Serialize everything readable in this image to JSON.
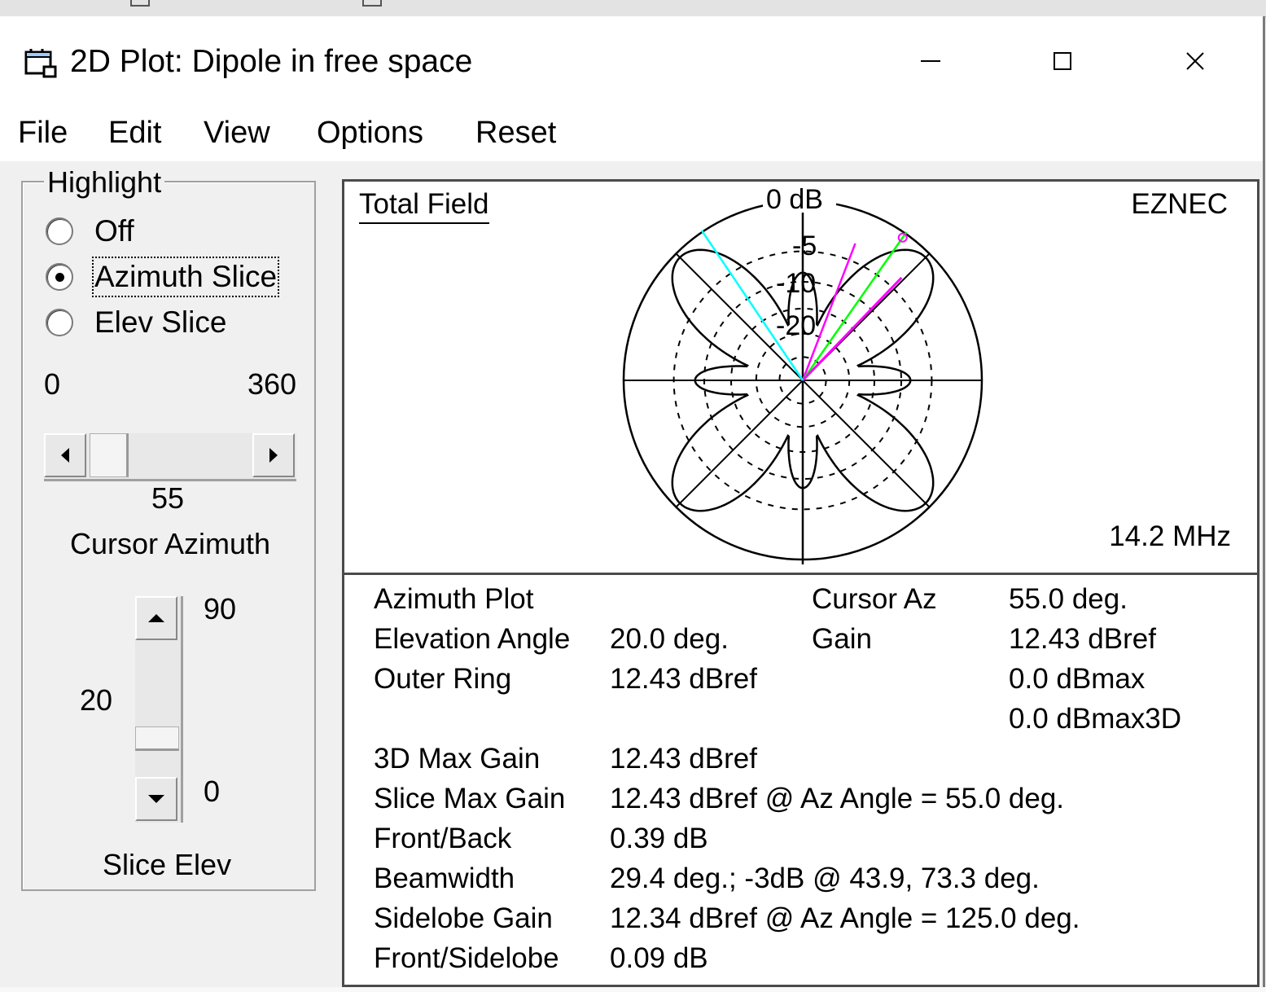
{
  "window": {
    "title": "2D Plot: Dipole in free space"
  },
  "menu": [
    "File",
    "Edit",
    "View",
    "Options",
    "Reset"
  ],
  "highlight": {
    "group_label": "Highlight",
    "options": [
      "Off",
      "Azimuth Slice",
      "Elev Slice"
    ],
    "selected": "Azimuth Slice"
  },
  "cursor_azimuth": {
    "min_label": "0",
    "max_label": "360",
    "value": "55",
    "label": "Cursor Azimuth",
    "position_fraction": 0.153
  },
  "slice_elev": {
    "max_label": "90",
    "min_label": "0",
    "value": "20",
    "label": "Slice Elev",
    "position_fraction": 0.222
  },
  "plot": {
    "title": "Total Field",
    "brand": "EZNEC",
    "frequency": "14.2 MHz",
    "ring_labels": [
      "0 dB",
      "-5",
      "-10",
      "-20"
    ],
    "colors": {
      "pattern": "#000000",
      "cursor": "#ff00ff",
      "beamwidth": "#00ff00",
      "sidelobe": "#00ffff"
    }
  },
  "results": {
    "rows": [
      {
        "label": "Azimuth Plot",
        "value": "",
        "label2": "Cursor Az",
        "value2": "55.0 deg."
      },
      {
        "label": "Elevation Angle",
        "value": "20.0 deg.",
        "label2": "Gain",
        "value2": "12.43 dBref"
      },
      {
        "label": "Outer Ring",
        "value": "12.43 dBref",
        "label2": "",
        "value2": "0.0 dBmax"
      },
      {
        "label": "",
        "value": "",
        "label2": "",
        "value2": "0.0 dBmax3D"
      },
      {
        "label": "3D Max Gain",
        "value": "12.43 dBref"
      },
      {
        "label": "Slice Max Gain",
        "value": "12.43 dBref @ Az Angle = 55.0 deg."
      },
      {
        "label": "Front/Back",
        "value": "0.39 dB"
      },
      {
        "label": "Beamwidth",
        "value": "29.4 deg.; -3dB @ 43.9, 73.3 deg."
      },
      {
        "label": "Sidelobe Gain",
        "value": "12.34 dBref @ Az Angle = 125.0 deg."
      },
      {
        "label": "Front/Sidelobe",
        "value": "0.09 dB"
      }
    ]
  }
}
